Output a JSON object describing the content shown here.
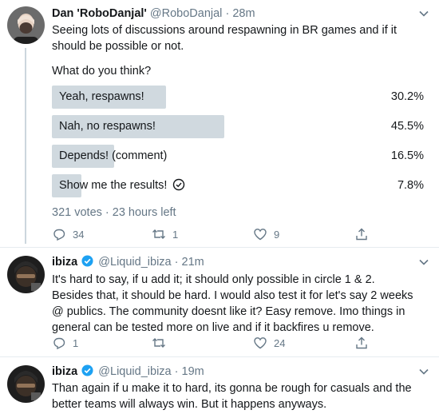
{
  "tweet1": {
    "name": "Dan 'RoboDanjal'",
    "handle": "@RoboDanjal",
    "dot": "·",
    "time": "28m",
    "text_line1": "Seeing lots of discussions around respawning in BR games and if it",
    "text_line2": "should be possible or not.",
    "question": "What do you think?",
    "poll": [
      {
        "label": "Yeah, respawns!",
        "percent_text": "30.2%",
        "fraction": 0.302
      },
      {
        "label": "Nah, no respawns!",
        "percent_text": "45.5%",
        "fraction": 0.455
      },
      {
        "label": "Depends! (comment)",
        "percent_text": "16.5%",
        "fraction": 0.165
      },
      {
        "label": "Show me the results!",
        "percent_text": "7.8%",
        "fraction": 0.078
      }
    ],
    "poll_meta": "321 votes · 23 hours left",
    "replies": "34",
    "retweets": "1",
    "likes": "9"
  },
  "tweet2": {
    "name": "ibiza",
    "handle": "@Liquid_ibiza",
    "dot": "·",
    "time": "21m",
    "lines": [
      "It's hard to say, if u add it; it should only possible in circle 1 & 2.",
      "Besides that, it should be hard. I would also test it for let's say 2 weeks",
      "@ publics. The community doesnt like it? Easy remove. Imo things in",
      "general can be tested more on live and if it backfires u remove."
    ],
    "replies": "1",
    "retweets": "",
    "likes": "24"
  },
  "tweet3": {
    "name": "ibiza",
    "handle": "@Liquid_ibiza",
    "dot": "·",
    "time": "19m",
    "lines": [
      "Than again if u make it to hard, its gonna be rough for casuals and the",
      "better teams will always win. But it happens anyways."
    ]
  },
  "colors": {
    "poll_bar": "#d0d9df",
    "verified": "#1da1f2",
    "secondary_text": "#657786"
  },
  "icons": [
    "chevron-down-icon",
    "reply-icon",
    "retweet-icon",
    "like-icon",
    "share-icon",
    "verified-icon",
    "check-circle-icon"
  ]
}
